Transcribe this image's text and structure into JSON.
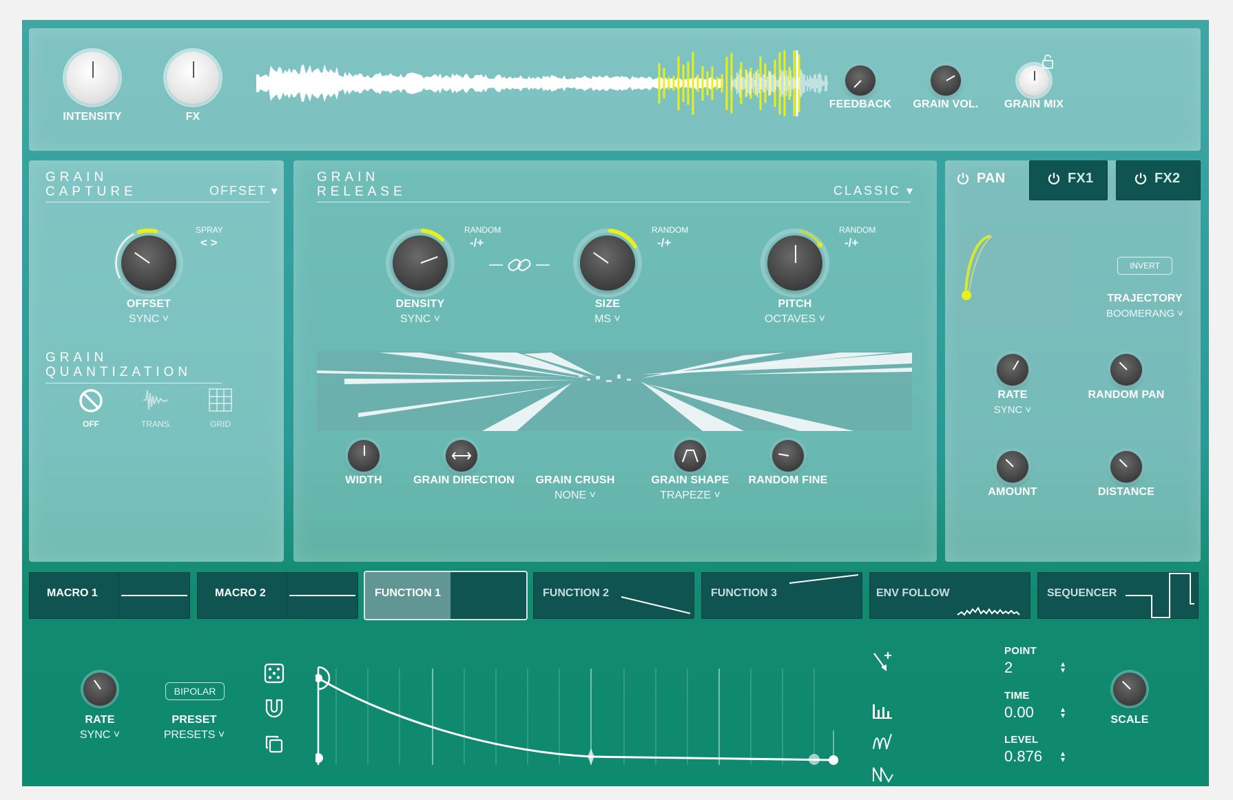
{
  "top_bar": {
    "knobs": [
      {
        "label": "INTENSITY"
      },
      {
        "label": "FX"
      },
      {
        "label": "FEEDBACK"
      },
      {
        "label": "GRAIN VOL."
      },
      {
        "label": "GRAIN MIX"
      }
    ]
  },
  "grain_capture": {
    "title_line1": "GRAIN",
    "title_line2": "CAPTURE",
    "mode": "OFFSET",
    "spray_label": "SPRAY",
    "spray_symbol": "< >",
    "offset_label": "OFFSET",
    "offset_sub": "SYNC"
  },
  "grain_quantization": {
    "title_line1": "GRAIN",
    "title_line2": "QUANTIZATION",
    "options": [
      {
        "label": "OFF",
        "icon": "off-icon",
        "selected": true
      },
      {
        "label": "TRANS.",
        "icon": "transient-icon",
        "selected": false
      },
      {
        "label": "GRID",
        "icon": "grid-icon",
        "selected": false
      }
    ]
  },
  "grain_release": {
    "title_line1": "GRAIN",
    "title_line2": "RELEASE",
    "mode": "CLASSIC",
    "random_label": "RANDOM",
    "random_value": "-/+",
    "knobs": [
      {
        "label": "DENSITY",
        "sub": "SYNC"
      },
      {
        "label": "SIZE",
        "sub": "MS"
      },
      {
        "label": "PITCH",
        "sub": "OCTAVES"
      }
    ],
    "bottom": [
      {
        "label": "WIDTH"
      },
      {
        "label": "GRAIN DIRECTION"
      },
      {
        "label": "GRAIN CRUSH",
        "sub": "NONE"
      },
      {
        "label": "GRAIN SHAPE",
        "sub": "TRAPEZE"
      },
      {
        "label": "RANDOM FINE"
      }
    ]
  },
  "pan": {
    "tabs": [
      {
        "label": "PAN",
        "active": true
      },
      {
        "label": "FX1",
        "active": false
      },
      {
        "label": "FX2",
        "active": false
      }
    ],
    "invert": "INVERT",
    "trajectory_label": "TRAJECTORY",
    "trajectory_value": "BOOMERANG",
    "knobs": [
      {
        "label": "RATE",
        "sub": "SYNC"
      },
      {
        "label": "RANDOM PAN"
      },
      {
        "label": "AMOUNT"
      },
      {
        "label": "DISTANCE"
      }
    ]
  },
  "mod_tabs": [
    {
      "label": "MACRO 1",
      "active": false
    },
    {
      "label": "MACRO 2",
      "active": false
    },
    {
      "label": "FUNCTION 1",
      "active": true
    },
    {
      "label": "FUNCTION 2",
      "active": false
    },
    {
      "label": "FUNCTION 3",
      "active": false
    },
    {
      "label": "ENV FOLLOW",
      "active": false
    },
    {
      "label": "SEQUENCER",
      "active": false
    }
  ],
  "function_editor": {
    "rate_label": "RATE",
    "rate_sub": "SYNC",
    "bipolar": "BIPOLAR",
    "preset_label": "PRESET",
    "preset_sub": "PRESETS",
    "point_label": "POINT",
    "point_value": "2",
    "time_label": "TIME",
    "time_value": "0.00",
    "level_label": "LEVEL",
    "level_value": "0.876",
    "scale_label": "SCALE"
  },
  "colors": {
    "accent": "#e8ef1a",
    "tab_bg": "#0f5451",
    "bottom_bg": "#128a70"
  }
}
